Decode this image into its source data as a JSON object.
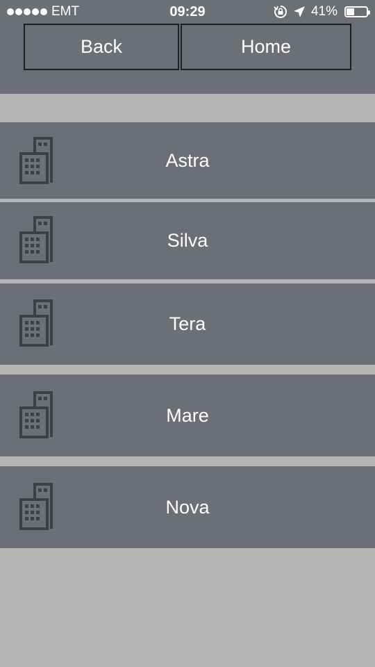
{
  "status_bar": {
    "carrier": "EMT",
    "time": "09:29",
    "battery_percent_text": "41%",
    "battery_level": 0.41,
    "icons": [
      "signal-dots-icon",
      "rotation-lock-icon",
      "location-arrow-icon",
      "battery-icon"
    ]
  },
  "nav": {
    "back_label": "Back",
    "home_label": "Home"
  },
  "buildings": [
    {
      "label": "Astra",
      "icon": "building-icon"
    },
    {
      "label": "Silva",
      "icon": "building-icon"
    },
    {
      "label": "Tera",
      "icon": "building-icon"
    },
    {
      "label": "Mare",
      "icon": "building-icon"
    },
    {
      "label": "Nova",
      "icon": "building-icon"
    }
  ],
  "colors": {
    "header_bg": "#6d6f77",
    "item_bg": "#6d6f77",
    "page_bg": "#b5b5b5",
    "text": "#ffffff",
    "icon": "#3f4045"
  }
}
